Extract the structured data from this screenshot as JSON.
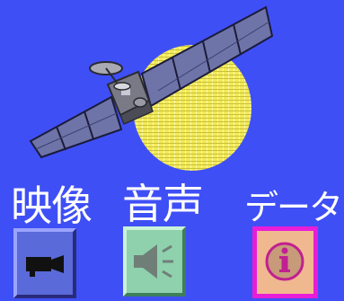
{
  "hero": {
    "icon": "satellite-with-coverage-beam"
  },
  "menu": [
    {
      "id": "video",
      "label": "映像",
      "icon": "video-camera-icon",
      "color": "#5a6ad9"
    },
    {
      "id": "audio",
      "label": "音声",
      "icon": "speaker-icon",
      "color": "#8fd1ad"
    },
    {
      "id": "data",
      "label": "データ",
      "icon": "info-icon",
      "color": "#f0b88f"
    }
  ],
  "colors": {
    "background": "#3f4ff6",
    "beam": "#f3ea58",
    "panel": "#6e74a8",
    "highlight": "#e81dd8"
  }
}
